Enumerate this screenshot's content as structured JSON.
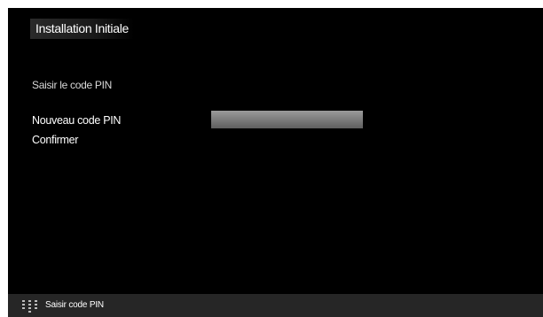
{
  "header": {
    "title": "Installation Initiale"
  },
  "main": {
    "instruction": "Saisir le code PIN",
    "new_pin_label": "Nouveau code PIN",
    "confirm_label": "Confirmer",
    "new_pin_value": ""
  },
  "footer": {
    "hint_icon": "numeric-keypad-icon",
    "hint_label": "Saisir code PIN"
  }
}
